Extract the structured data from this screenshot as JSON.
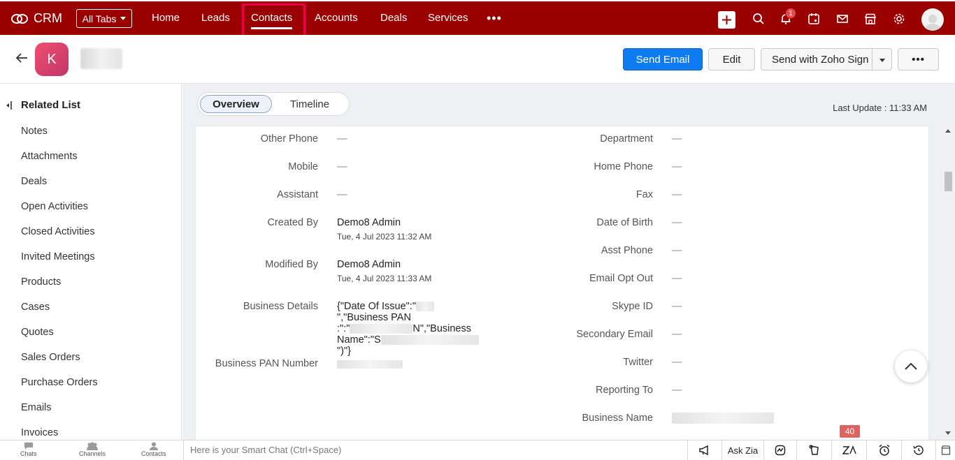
{
  "app": {
    "name": "CRM"
  },
  "nav": {
    "all_tabs_label": "All Tabs",
    "tabs": [
      {
        "label": "Home"
      },
      {
        "label": "Leads"
      },
      {
        "label": "Contacts",
        "active": true
      },
      {
        "label": "Accounts"
      },
      {
        "label": "Deals"
      },
      {
        "label": "Services"
      }
    ],
    "more_label": "•••",
    "notification_count": "1",
    "icons": [
      "plus-icon",
      "search-icon",
      "bell-icon",
      "calendar-icon",
      "mail-icon",
      "marketplace-icon",
      "gear-icon",
      "user-avatar"
    ]
  },
  "record": {
    "avatar_letter": "K",
    "send_email_label": "Send Email",
    "edit_label": "Edit",
    "zoho_sign_label": "Send with Zoho Sign",
    "more_label": "•••"
  },
  "sidebar": {
    "title": "Related List",
    "items": [
      "Notes",
      "Attachments",
      "Deals",
      "Open Activities",
      "Closed Activities",
      "Invited Meetings",
      "Products",
      "Cases",
      "Quotes",
      "Sales Orders",
      "Purchase Orders",
      "Emails",
      "Invoices"
    ]
  },
  "main": {
    "tabs": {
      "overview": "Overview",
      "timeline": "Timeline"
    },
    "last_update": "Last Update : 11:33 AM"
  },
  "fields_left": {
    "other_phone": {
      "label": "Other Phone",
      "value": "—"
    },
    "mobile": {
      "label": "Mobile",
      "value": "—"
    },
    "assistant": {
      "label": "Assistant",
      "value": "—"
    },
    "created_by": {
      "label": "Created By",
      "value": "Demo8 Admin",
      "sub": "Tue, 4 Jul 2023 11:32 AM"
    },
    "modified_by": {
      "label": "Modified By",
      "value": "Demo8 Admin",
      "sub": "Tue, 4 Jul 2023 11:33 AM"
    },
    "business_details": {
      "label": "Business Details",
      "p1": "{\"Date Of Issue\":\"",
      "p2": "\",\"Business PAN",
      "p3": ":\":\"",
      "p4": "N\",\"Business",
      "p5": "Name\":\"S",
      "p6": "\")\"}"
    },
    "business_pan": {
      "label": "Business PAN Number"
    }
  },
  "fields_right": {
    "department": {
      "label": "Department",
      "value": "—"
    },
    "home_phone": {
      "label": "Home Phone",
      "value": "—"
    },
    "fax": {
      "label": "Fax",
      "value": "—"
    },
    "dob": {
      "label": "Date of Birth",
      "value": "—"
    },
    "asst_phone": {
      "label": "Asst Phone",
      "value": "—"
    },
    "email_opt_out": {
      "label": "Email Opt Out",
      "value": "—"
    },
    "skype": {
      "label": "Skype ID",
      "value": "—"
    },
    "secondary_email": {
      "label": "Secondary Email",
      "value": "—"
    },
    "twitter": {
      "label": "Twitter",
      "value": "—"
    },
    "reporting_to": {
      "label": "Reporting To",
      "value": "—"
    },
    "business_name": {
      "label": "Business Name"
    }
  },
  "bottom": {
    "chats": "Chats",
    "channels": "Channels",
    "contacts": "Contacts",
    "chat_placeholder": "Here is your Smart Chat (Ctrl+Space)",
    "ask_zia": "Ask Zia",
    "zia_count": "40"
  }
}
